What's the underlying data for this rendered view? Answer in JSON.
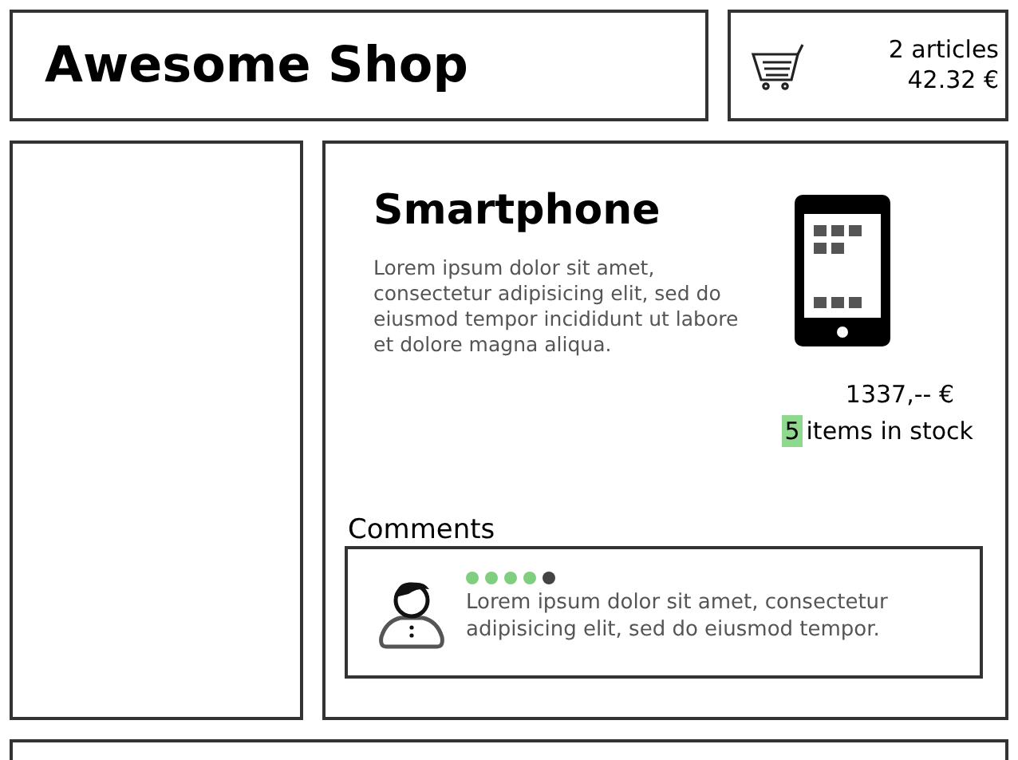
{
  "header": {
    "title": "Awesome Shop"
  },
  "cart": {
    "count": "2 articles",
    "total": "42.32 €"
  },
  "product": {
    "name": "Smartphone",
    "description": "Lorem ipsum dolor sit amet, consectetur adipisicing elit, sed do eiusmod tempor incididunt ut labore et dolore magna aliqua.",
    "price": "1337,-- €",
    "stock_count": "5",
    "stock_label": "items in stock"
  },
  "comments": {
    "heading": "Comments",
    "items": [
      {
        "stars": 4,
        "text": "Lorem ipsum dolor sit amet, consectetur adipisicing elit, sed do eiusmod tempor."
      }
    ]
  }
}
